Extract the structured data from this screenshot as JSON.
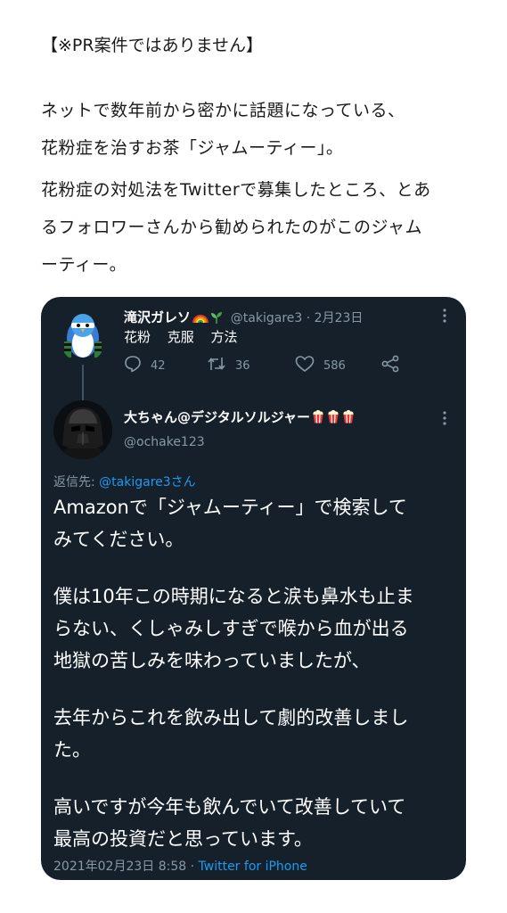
{
  "article": {
    "pr_note": "【※PR案件ではありません】",
    "paragraph1": [
      "ネットで数年前から密かに話題になっている、",
      "花粉症を治すお茶「ジャムーティー」。"
    ],
    "paragraph2": [
      "花粉症の対処法をTwitterで募集したところ、とあ",
      "るフォロワーさんから勧められたのがこのジャム",
      "ーティー。"
    ]
  },
  "tweet": {
    "original": {
      "name": "滝沢ガレソ",
      "handle": "@takigare3",
      "separator": " · ",
      "date": "2月23日",
      "text": "花粉 克服 方法",
      "replies": "42",
      "retweets": "36",
      "likes": "586"
    },
    "reply": {
      "name": "大ちゃん@デジタルソルジャー",
      "handle": "@ochake123",
      "replying_to_label": "返信先: ",
      "replying_to_mention": "@takigare3さん",
      "body": [
        [
          "Amazonで「ジャムーティー」で検索して",
          "みてください。"
        ],
        [
          "僕は10年この時期になると涙も鼻水も止ま",
          "らない、くしゃみしすぎで喉から血が出る",
          "地獄の苦しみを味わっていましたが、"
        ],
        [
          "去年からこれを飲み出して劇的改善しまし",
          "た。"
        ],
        [
          "高いですが今年も飲んでいて改善していて",
          "最高の投資だと思っています。"
        ]
      ],
      "timestamp": "2021年02月23日 8:58",
      "footer_separator": " · ",
      "source": "Twitter for iPhone"
    }
  },
  "icons": {
    "reply": "reply-icon",
    "retweet": "retweet-icon",
    "like": "heart-icon",
    "share": "share-icon",
    "more": "more-vertical-icon",
    "emoji_rainbow": "rainbow-emoji",
    "emoji_sprout": "sprout-emoji",
    "emoji_popcorn": "popcorn-emoji"
  },
  "colors": {
    "card_background": "#15202b",
    "secondary_text": "#8899a6",
    "link_blue": "#1d9bf0",
    "article_text": "#1a1a1a"
  }
}
